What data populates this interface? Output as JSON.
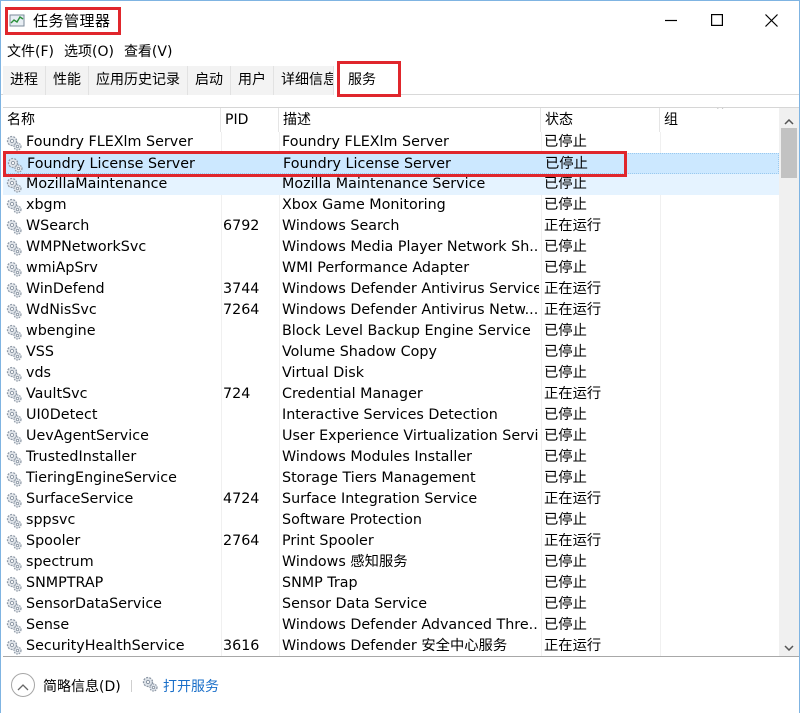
{
  "window": {
    "title": "任务管理器",
    "controls": {
      "minimize": "minimize",
      "maximize": "maximize",
      "close": "close"
    }
  },
  "menu": [
    {
      "label": "文件(F)"
    },
    {
      "label": "选项(O)"
    },
    {
      "label": "查看(V)"
    }
  ],
  "tabs": [
    {
      "label": "进程",
      "active": false
    },
    {
      "label": "性能",
      "active": false
    },
    {
      "label": "应用历史记录",
      "active": false
    },
    {
      "label": "启动",
      "active": false
    },
    {
      "label": "用户",
      "active": false
    },
    {
      "label": "详细信息",
      "active": false
    },
    {
      "label": "服务",
      "active": true
    }
  ],
  "table": {
    "columns": [
      {
        "key": "name",
        "label": "名称"
      },
      {
        "key": "pid",
        "label": "PID"
      },
      {
        "key": "desc",
        "label": "描述"
      },
      {
        "key": "status",
        "label": "状态"
      },
      {
        "key": "group",
        "label": "组",
        "sorted": "ascending"
      }
    ],
    "sort_indicator": "^",
    "rows": [
      {
        "name": "Foundry FLEXlm Server",
        "pid": "",
        "desc": "Foundry FLEXlm Server",
        "status": "已停止",
        "group": ""
      },
      {
        "name": "Foundry License Server",
        "pid": "",
        "desc": "Foundry License Server",
        "status": "已停止",
        "group": "",
        "selected": true
      },
      {
        "name": "MozillaMaintenance",
        "pid": "",
        "desc": "Mozilla Maintenance Service",
        "status": "已停止",
        "group": "",
        "hover": true
      },
      {
        "name": "xbgm",
        "pid": "",
        "desc": "Xbox Game Monitoring",
        "status": "已停止",
        "group": ""
      },
      {
        "name": "WSearch",
        "pid": "6792",
        "desc": "Windows Search",
        "status": "正在运行",
        "group": ""
      },
      {
        "name": "WMPNetworkSvc",
        "pid": "",
        "desc": "Windows Media Player Network Sh...",
        "status": "已停止",
        "group": ""
      },
      {
        "name": "wmiApSrv",
        "pid": "",
        "desc": "WMI Performance Adapter",
        "status": "已停止",
        "group": ""
      },
      {
        "name": "WinDefend",
        "pid": "3744",
        "desc": "Windows Defender Antivirus Service",
        "status": "正在运行",
        "group": ""
      },
      {
        "name": "WdNisSvc",
        "pid": "7264",
        "desc": "Windows Defender Antivirus Netw...",
        "status": "正在运行",
        "group": ""
      },
      {
        "name": "wbengine",
        "pid": "",
        "desc": "Block Level Backup Engine Service",
        "status": "已停止",
        "group": ""
      },
      {
        "name": "VSS",
        "pid": "",
        "desc": "Volume Shadow Copy",
        "status": "已停止",
        "group": ""
      },
      {
        "name": "vds",
        "pid": "",
        "desc": "Virtual Disk",
        "status": "已停止",
        "group": ""
      },
      {
        "name": "VaultSvc",
        "pid": "724",
        "desc": "Credential Manager",
        "status": "正在运行",
        "group": ""
      },
      {
        "name": "UI0Detect",
        "pid": "",
        "desc": "Interactive Services Detection",
        "status": "已停止",
        "group": ""
      },
      {
        "name": "UevAgentService",
        "pid": "",
        "desc": "User Experience Virtualization Servi...",
        "status": "已停止",
        "group": ""
      },
      {
        "name": "TrustedInstaller",
        "pid": "",
        "desc": "Windows Modules Installer",
        "status": "已停止",
        "group": ""
      },
      {
        "name": "TieringEngineService",
        "pid": "",
        "desc": "Storage Tiers Management",
        "status": "已停止",
        "group": ""
      },
      {
        "name": "SurfaceService",
        "pid": "4724",
        "desc": "Surface Integration Service",
        "status": "正在运行",
        "group": ""
      },
      {
        "name": "sppsvc",
        "pid": "",
        "desc": "Software Protection",
        "status": "已停止",
        "group": ""
      },
      {
        "name": "Spooler",
        "pid": "2764",
        "desc": "Print Spooler",
        "status": "正在运行",
        "group": ""
      },
      {
        "name": "spectrum",
        "pid": "",
        "desc": "Windows 感知服务",
        "status": "已停止",
        "group": ""
      },
      {
        "name": "SNMPTRAP",
        "pid": "",
        "desc": "SNMP Trap",
        "status": "已停止",
        "group": ""
      },
      {
        "name": "SensorDataService",
        "pid": "",
        "desc": "Sensor Data Service",
        "status": "已停止",
        "group": ""
      },
      {
        "name": "Sense",
        "pid": "",
        "desc": "Windows Defender Advanced Thre...",
        "status": "已停止",
        "group": ""
      },
      {
        "name": "SecurityHealthService",
        "pid": "3616",
        "desc": "Windows Defender 安全中心服务",
        "status": "正在运行",
        "group": ""
      }
    ]
  },
  "footer": {
    "summary_label": "简略信息(D)",
    "open_services_label": "打开服务"
  },
  "colors": {
    "annotation": "#e0262c",
    "selection": "#cce8ff",
    "hover": "#e5f3ff",
    "link": "#1a6fc9"
  }
}
